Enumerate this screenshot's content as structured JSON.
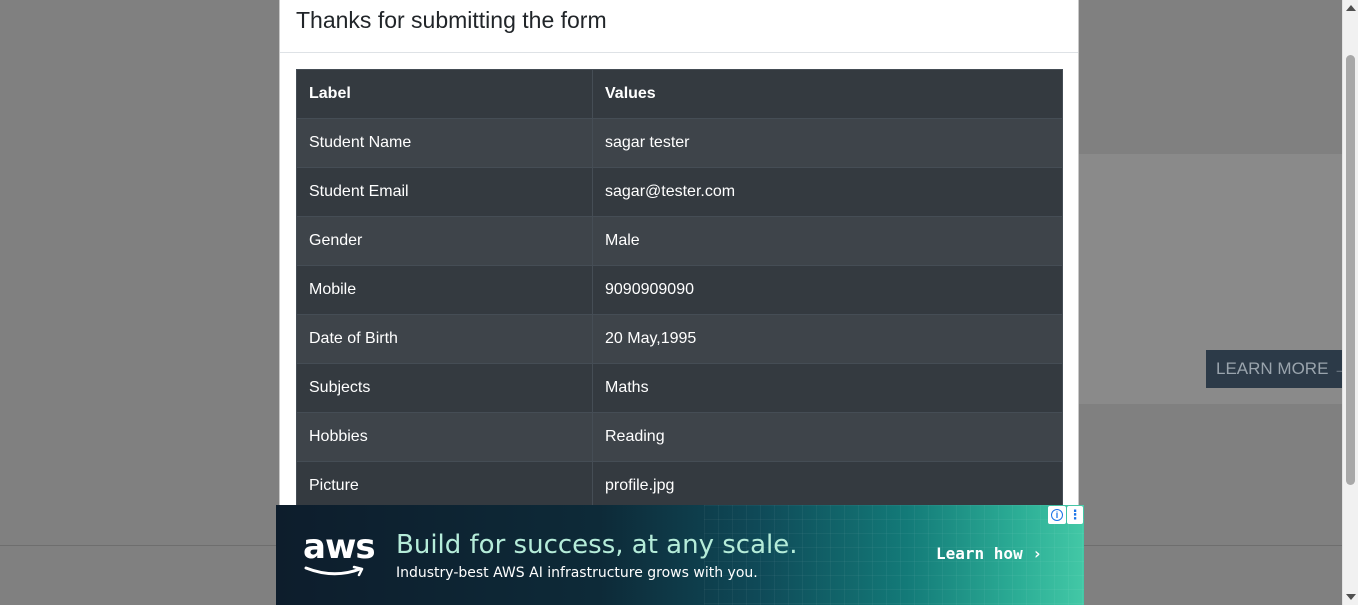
{
  "background": {
    "learn_more": "LEARN MORE →"
  },
  "modal": {
    "title": "Thanks for submitting the form",
    "table": {
      "headers": [
        "Label",
        "Values"
      ],
      "rows": [
        {
          "label": "Student Name",
          "value": "sagar tester"
        },
        {
          "label": "Student Email",
          "value": "sagar@tester.com"
        },
        {
          "label": "Gender",
          "value": "Male"
        },
        {
          "label": "Mobile",
          "value": "9090909090"
        },
        {
          "label": "Date of Birth",
          "value": "20 May,1995"
        },
        {
          "label": "Subjects",
          "value": "Maths"
        },
        {
          "label": "Hobbies",
          "value": "Reading"
        },
        {
          "label": "Picture",
          "value": "profile.jpg"
        }
      ]
    }
  },
  "ad": {
    "logo": "aws",
    "headline": "Build for success, at any scale.",
    "subtext": "Industry-best AWS AI infrastructure grows with you.",
    "cta": "Learn how ›",
    "info_icon": "i",
    "more_icon": "⋮"
  }
}
